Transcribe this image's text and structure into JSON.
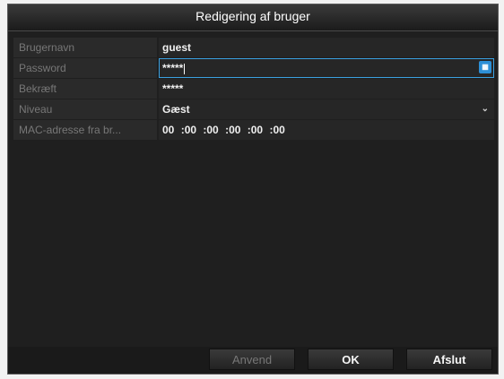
{
  "window": {
    "title": "Redigering af bruger"
  },
  "form": {
    "username": {
      "label": "Brugernavn",
      "value": "guest"
    },
    "password": {
      "label": "Password",
      "value": "*****",
      "keyboard_icon": "keyboard-icon"
    },
    "confirm": {
      "label": "Bekræft",
      "value": "*****"
    },
    "level": {
      "label": "Niveau",
      "value": "Gæst",
      "icon": "chevron-down-icon"
    },
    "mac": {
      "label": "MAC-adresse fra br...",
      "parts": [
        "00",
        ":00",
        ":00",
        ":00",
        ":00",
        ":00"
      ]
    }
  },
  "buttons": {
    "apply": "Anvend",
    "ok": "OK",
    "exit": "Afslut"
  },
  "colors": {
    "accent": "#3aa0e0",
    "window_bg": "#1f1f1f"
  }
}
